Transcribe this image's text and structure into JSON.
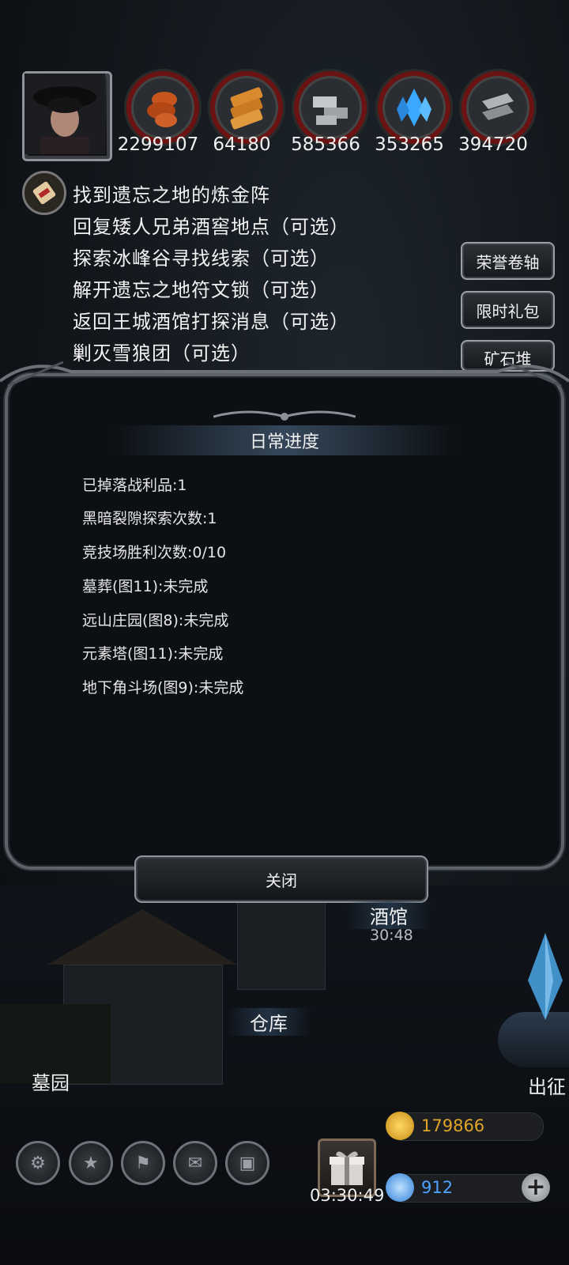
{
  "resources": [
    {
      "icon": "ore-icon",
      "value": "2299107",
      "color": "#c8541e"
    },
    {
      "icon": "wood-icon",
      "value": "64180",
      "color": "#d98a2e"
    },
    {
      "icon": "stone-icon",
      "value": "585366",
      "color": "#b5b8bb"
    },
    {
      "icon": "crystal-icon",
      "value": "353265",
      "color": "#3aa8ff"
    },
    {
      "icon": "iron-icon",
      "value": "394720",
      "color": "#9c9fa2"
    }
  ],
  "quests": [
    "找到遗忘之地的炼金阵",
    "回复矮人兄弟酒窖地点（可选）",
    "探索冰峰谷寻找线索（可选）",
    "解开遗忘之地符文锁（可选）",
    "返回王城酒馆打探消息（可选）",
    "剿灭雪狼团（可选）"
  ],
  "side_buttons": [
    "荣誉卷轴",
    "限时礼包",
    "矿石堆"
  ],
  "dialog": {
    "title": "日常进度",
    "lines": [
      "已掉落战利品:1",
      "黑暗裂隙探索次数:1",
      "竞技场胜利次数:0/10",
      "墓葬(图11):未完成",
      "远山庄园(图8):未完成",
      "元素塔(图11):未完成",
      "地下角斗场(图9):未完成"
    ],
    "close_label": "关闭"
  },
  "map_labels": {
    "tavern": "酒馆",
    "tavern_timer": "30:48",
    "warehouse": "仓库",
    "cemetery": "墓园",
    "expedition": "出征"
  },
  "bottom": {
    "gift_timer": "03:30:49",
    "gold": "179866",
    "gems": "912",
    "gold_color": "#e0a428",
    "gem_color": "#4da3ff"
  }
}
